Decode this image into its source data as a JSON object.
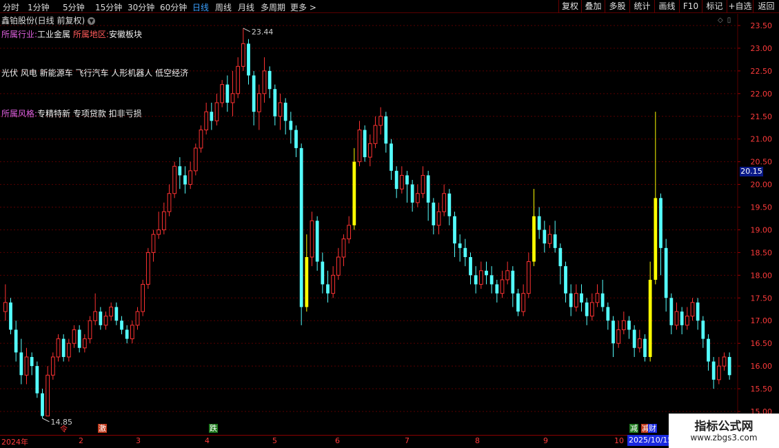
{
  "toolbar": {
    "periods": [
      "分时",
      "1分钟",
      "5分钟",
      "15分钟",
      "30分钟",
      "60分钟",
      "日线",
      "周线",
      "月线",
      "多周期",
      "更多 >"
    ],
    "active_period": "日线",
    "buttons": [
      "复权",
      "叠加",
      "多股",
      "统计",
      "画线",
      "F10",
      "标记",
      "+自选",
      "返回"
    ]
  },
  "stock": {
    "title": "鑫铂股份(日线 前复权)"
  },
  "info": {
    "industry_label": "所属行业:",
    "industry": "工业金属",
    "region_label": "所属地区:",
    "region": "安徽板块",
    "concepts": "光伏 风电 新能源车 飞行汽车 人形机器人 低空经济",
    "style_label": "所属风格:",
    "style": "专精特新 专项贷款 扣非亏损"
  },
  "price_axis": {
    "labels": [
      "23.50",
      "23.00",
      "22.50",
      "22.00",
      "21.50",
      "21.00",
      "20.50",
      "20.00",
      "19.50",
      "19.00",
      "18.50",
      "18.00",
      "17.50",
      "17.00",
      "16.50",
      "16.00",
      "15.50",
      "15.00"
    ],
    "current_price": "20.15"
  },
  "annotations": {
    "high": "23.44",
    "low": "14.85"
  },
  "timeline": {
    "months": [
      "2024年",
      "2",
      "3",
      "4",
      "5",
      "6",
      "7",
      "8",
      "9",
      "10"
    ],
    "date_badge": "2025/10/15"
  },
  "markers": [
    "令",
    "激",
    "跌",
    "减",
    "减",
    "财"
  ],
  "watermark": {
    "title": "指标公式网",
    "url": "www.zbgs3.com"
  },
  "colors": {
    "up": "#ff3232",
    "down": "#54ffff",
    "yellow": "#ffff00",
    "grid": "#5a0000",
    "active": "#3aa0ff"
  },
  "chart_data": {
    "type": "candlestick",
    "y_axis_range": [
      15.0,
      23.5
    ],
    "series": [
      {
        "values": [
          [
            17.2,
            17.4,
            17.8,
            17.0
          ],
          [
            17.4,
            16.8,
            17.5,
            16.7
          ],
          [
            16.8,
            16.3,
            17.0,
            16.1
          ],
          [
            16.3,
            15.8,
            16.6,
            15.6
          ],
          [
            15.8,
            16.2,
            16.4,
            15.6
          ],
          [
            16.2,
            16.0,
            16.3,
            15.8
          ],
          [
            16.0,
            15.4,
            16.1,
            15.3
          ],
          [
            15.4,
            14.9,
            15.5,
            14.85
          ],
          [
            14.9,
            15.8,
            16.0,
            14.9
          ],
          [
            15.8,
            16.2,
            16.3,
            15.7
          ],
          [
            16.2,
            16.6,
            16.7,
            16.1
          ],
          [
            16.6,
            16.2,
            16.7,
            16.1
          ],
          [
            16.2,
            16.5,
            16.6,
            16.1
          ],
          [
            16.5,
            16.8,
            16.9,
            16.4
          ],
          [
            16.8,
            16.4,
            16.9,
            16.3
          ],
          [
            16.4,
            16.6,
            16.7,
            16.3
          ],
          [
            16.6,
            17.0,
            17.1,
            16.5
          ],
          [
            17.0,
            17.2,
            17.6,
            16.9
          ],
          [
            17.2,
            16.9,
            17.3,
            16.8
          ],
          [
            16.9,
            17.1,
            17.2,
            16.8
          ],
          [
            17.1,
            17.3,
            17.4,
            17.0
          ],
          [
            17.3,
            17.0,
            17.4,
            16.9
          ],
          [
            17.0,
            16.8,
            17.1,
            16.7
          ],
          [
            16.8,
            16.6,
            16.9,
            16.5
          ],
          [
            16.6,
            16.9,
            17.0,
            16.5
          ],
          [
            16.9,
            17.2,
            17.3,
            16.8
          ],
          [
            17.2,
            17.8,
            17.9,
            17.1
          ],
          [
            17.8,
            18.5,
            18.6,
            17.7
          ],
          [
            18.5,
            18.9,
            19.0,
            18.3
          ],
          [
            18.9,
            19.0,
            19.4,
            18.8
          ],
          [
            19.0,
            19.4,
            19.6,
            18.9
          ],
          [
            19.4,
            19.8,
            20.0,
            19.3
          ],
          [
            19.8,
            20.4,
            20.5,
            19.7
          ],
          [
            20.4,
            20.2,
            20.6,
            19.9
          ],
          [
            20.2,
            20.0,
            20.4,
            19.8
          ],
          [
            20.0,
            20.3,
            20.5,
            19.9
          ],
          [
            20.3,
            20.8,
            20.9,
            20.2
          ],
          [
            20.8,
            21.2,
            21.3,
            20.7
          ],
          [
            21.2,
            21.6,
            21.8,
            21.1
          ],
          [
            21.6,
            21.4,
            21.8,
            21.2
          ],
          [
            21.4,
            21.8,
            22.0,
            21.3
          ],
          [
            21.8,
            22.2,
            22.3,
            21.7
          ],
          [
            22.2,
            21.8,
            22.4,
            21.6
          ],
          [
            21.8,
            22.0,
            22.5,
            21.5
          ],
          [
            22.0,
            22.6,
            22.8,
            21.9
          ],
          [
            22.6,
            23.1,
            23.44,
            22.5
          ],
          [
            23.1,
            22.4,
            23.2,
            22.2
          ],
          [
            22.4,
            21.6,
            22.5,
            21.3
          ],
          [
            21.6,
            22.0,
            22.2,
            21.2
          ],
          [
            22.0,
            22.5,
            22.8,
            21.8
          ],
          [
            22.5,
            22.1,
            22.6,
            21.9
          ],
          [
            22.1,
            21.5,
            22.2,
            21.3
          ],
          [
            21.5,
            21.8,
            22.0,
            21.2
          ],
          [
            21.8,
            21.4,
            21.9,
            21.1
          ],
          [
            21.4,
            21.2,
            21.6,
            20.9
          ],
          [
            21.2,
            20.8,
            21.3,
            20.6
          ],
          [
            20.8,
            17.3,
            20.9,
            16.9
          ],
          [
            17.3,
            18.4,
            18.9,
            17.2
          ],
          [
            18.4,
            19.2,
            19.4,
            18.2
          ],
          [
            19.2,
            18.3,
            19.3,
            18.1
          ],
          [
            18.3,
            17.8,
            18.5,
            17.6
          ],
          [
            17.8,
            17.6,
            18.1,
            17.4
          ],
          [
            17.6,
            18.0,
            18.2,
            17.5
          ],
          [
            18.0,
            18.4,
            18.6,
            17.9
          ],
          [
            18.4,
            18.8,
            18.9,
            18.2
          ],
          [
            18.8,
            19.1,
            19.3,
            18.7
          ],
          [
            19.1,
            20.5,
            20.8,
            19.0
          ],
          [
            20.5,
            21.2,
            21.4,
            20.4
          ],
          [
            21.2,
            20.6,
            21.3,
            20.5
          ],
          [
            20.6,
            20.9,
            21.1,
            20.4
          ],
          [
            20.9,
            21.3,
            21.5,
            20.8
          ],
          [
            21.3,
            21.5,
            21.7,
            21.1
          ],
          [
            21.5,
            20.9,
            21.6,
            20.7
          ],
          [
            20.9,
            20.3,
            21.0,
            20.1
          ],
          [
            20.3,
            19.9,
            20.4,
            19.7
          ],
          [
            19.9,
            20.2,
            20.4,
            19.8
          ],
          [
            20.2,
            20.0,
            20.3,
            19.6
          ],
          [
            20.0,
            19.6,
            20.1,
            19.4
          ],
          [
            19.6,
            19.8,
            20.0,
            19.5
          ],
          [
            19.8,
            20.2,
            20.4,
            19.7
          ],
          [
            20.2,
            19.6,
            20.3,
            19.2
          ],
          [
            19.6,
            19.1,
            19.7,
            18.9
          ],
          [
            19.1,
            19.4,
            19.6,
            18.9
          ],
          [
            19.4,
            19.8,
            20.0,
            19.3
          ],
          [
            19.8,
            19.3,
            19.9,
            19.1
          ],
          [
            19.3,
            18.7,
            19.4,
            18.4
          ],
          [
            18.7,
            18.6,
            18.9,
            18.3
          ],
          [
            18.6,
            18.4,
            18.8,
            18.2
          ],
          [
            18.4,
            18.0,
            18.5,
            17.8
          ],
          [
            18.0,
            17.8,
            18.2,
            17.6
          ],
          [
            17.8,
            18.1,
            18.3,
            17.7
          ],
          [
            18.1,
            18.0,
            18.3,
            17.8
          ],
          [
            18.0,
            17.8,
            18.2,
            17.6
          ],
          [
            17.8,
            17.6,
            17.9,
            17.4
          ],
          [
            17.6,
            17.9,
            18.1,
            17.5
          ],
          [
            17.9,
            18.1,
            18.3,
            17.8
          ],
          [
            18.1,
            17.6,
            18.2,
            17.3
          ],
          [
            17.6,
            17.2,
            17.7,
            17.1
          ],
          [
            17.2,
            17.6,
            17.8,
            17.1
          ],
          [
            17.6,
            18.3,
            18.5,
            17.5
          ],
          [
            18.3,
            19.3,
            19.9,
            18.2
          ],
          [
            19.3,
            19.0,
            19.5,
            18.8
          ],
          [
            19.0,
            18.7,
            19.2,
            18.5
          ],
          [
            18.7,
            18.9,
            19.1,
            18.6
          ],
          [
            18.9,
            18.6,
            19.2,
            18.5
          ],
          [
            18.6,
            18.2,
            18.7,
            17.8
          ],
          [
            18.2,
            17.6,
            18.3,
            17.4
          ],
          [
            17.6,
            17.3,
            17.8,
            17.1
          ],
          [
            17.3,
            17.6,
            17.8,
            17.2
          ],
          [
            17.6,
            17.4,
            17.8,
            17.2
          ],
          [
            17.4,
            17.1,
            17.5,
            16.9
          ],
          [
            17.1,
            17.4,
            17.6,
            17.0
          ],
          [
            17.4,
            17.6,
            17.8,
            17.3
          ],
          [
            17.6,
            17.3,
            17.9,
            17.2
          ],
          [
            17.3,
            17.0,
            17.4,
            16.8
          ],
          [
            17.0,
            16.5,
            17.1,
            16.2
          ],
          [
            16.5,
            16.8,
            17.0,
            16.4
          ],
          [
            16.8,
            17.0,
            17.2,
            16.7
          ],
          [
            17.0,
            16.8,
            17.1,
            16.6
          ],
          [
            16.8,
            16.4,
            16.9,
            16.2
          ],
          [
            16.4,
            16.6,
            16.8,
            16.3
          ],
          [
            16.6,
            16.2,
            16.7,
            16.1
          ],
          [
            16.2,
            17.9,
            18.3,
            16.1
          ],
          [
            17.9,
            19.7,
            21.6,
            17.8
          ],
          [
            19.7,
            18.6,
            19.8,
            18.0
          ],
          [
            18.6,
            17.5,
            18.8,
            17.2
          ],
          [
            17.5,
            16.9,
            17.6,
            16.7
          ],
          [
            16.9,
            17.2,
            17.4,
            16.8
          ],
          [
            17.2,
            16.9,
            17.3,
            16.7
          ],
          [
            16.9,
            17.1,
            17.3,
            16.8
          ],
          [
            17.1,
            17.4,
            17.5,
            17.0
          ],
          [
            17.4,
            17.0,
            17.5,
            16.8
          ],
          [
            17.0,
            16.6,
            17.1,
            16.4
          ],
          [
            16.6,
            16.1,
            16.7,
            15.9
          ],
          [
            16.1,
            15.7,
            16.2,
            15.5
          ],
          [
            15.7,
            16.0,
            16.2,
            15.6
          ],
          [
            16.0,
            16.2,
            16.3,
            15.9
          ],
          [
            16.2,
            15.8,
            16.3,
            15.7
          ]
        ]
      }
    ]
  }
}
